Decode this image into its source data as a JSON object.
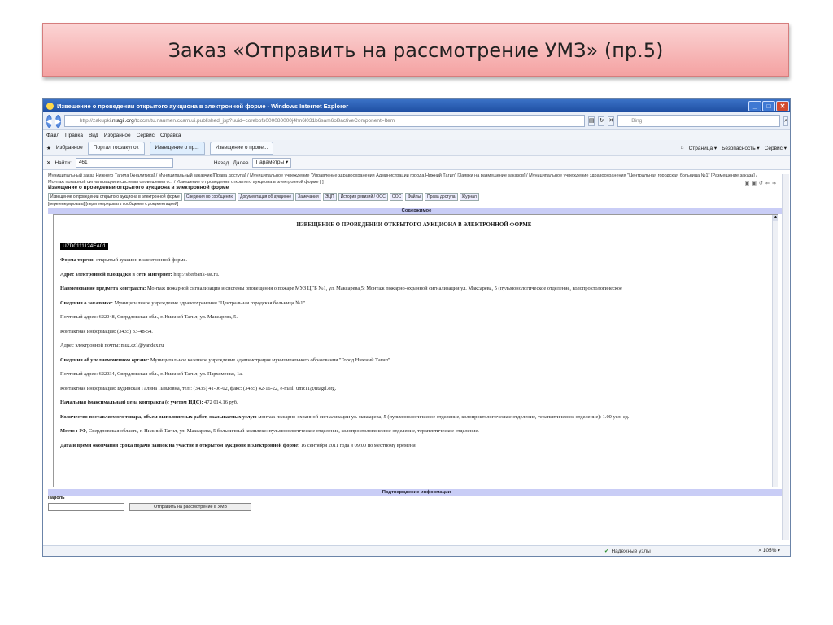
{
  "slide": {
    "title": "Заказ «Отправить на рассмотрение УМЗ» (пр.5)"
  },
  "window": {
    "title": "Извещение о проведении открытого аукциона в электронной форме - Windows Internet Explorer"
  },
  "address": {
    "url_prefix": "http://zakupki.",
    "url_domain": "ntagil.org",
    "url_rest": "/tcccm/tu.naumen.ccam.ui.published_jsp?uuid=corebofs000080000j4hn6l031b6sam6oBactiveComponent=Item",
    "search_placeholder": "Bing"
  },
  "menu": [
    "Файл",
    "Правка",
    "Вид",
    "Избранное",
    "Сервис",
    "Справка"
  ],
  "favorites": {
    "label": "Избранное",
    "tabs": [
      "Портал госзакупок",
      "Извещение о пр...",
      "Извещение о прове..."
    ],
    "tools": [
      "Страница ▾",
      "Безопасность ▾",
      "Сервис ▾"
    ]
  },
  "find": {
    "label": "Найти:",
    "value": "461",
    "prev": "Назад",
    "next": "Далее",
    "params": "Параметры ▾"
  },
  "breadcrumb": "Муниципальный заказ Нижнего Тагила [Аналитика] / Муниципальный заказчик [Права доступа] / Муниципальное учреждение \"Управление здравоохранения Администрации города Нижний Тагил\" [Заявки на размещение заказов] / Муниципальное учреждение здравоохранения \"Центральная городская больница №1\" [Размещение заказа] / Монтаж пожарной сигнализации и системы оповещения о... / Извещение о проведении открытого аукциона в электронной форме [ ]",
  "page_title": "Извещение о проведении открытого аукциона в электронной форме",
  "tabs": [
    "Извещение о проведении открытого аукциона в электронной форме",
    "Сведения по сообщению",
    "Документация об аукционе",
    "Замечания",
    "ЭЦП",
    "История ревизий / ООС",
    "ООС",
    "Файлы",
    "Права доступа",
    "Журнал"
  ],
  "regen": "[перегенерировать] [перегенерировать сообщение с документацией]",
  "section_title": "Содержимое",
  "document": {
    "title": "ИЗВЕЩЕНИЕ О ПРОВЕДЕНИИ ОТКРЫТОГО АУКЦИОНА В ЭЛЕКТРОННОЙ ФОРМЕ",
    "code": "UZD0111124EA01",
    "lines": [
      {
        "b": "Форма торгов:",
        "t": " открытый аукцион в электронной форме."
      },
      {
        "b": "Адрес электронной площадки в сети Интернет:",
        "t": " http://sberbank-ast.ru."
      },
      {
        "b": "Наименование предмета контракта:",
        "t": " Монтаж пожарной сигнализации и системы оповещения о пожаре МУЗ ЦГБ №1, ул. Максарева,5: Монтаж пожарно-охранной сигнализации ул. Максарева, 5 (пульмонологическое отделение, колопроктологическое"
      },
      {
        "b": "Сведения о заказчике:",
        "t": " Муниципальное учреждение здравоохранения \"Центральная городская больница №1\"."
      },
      {
        "b": "",
        "t": "Почтовый адрес: 622048, Свердловская обл., г. Нижний Тагил, ул. Максарева, 5."
      },
      {
        "b": "",
        "t": "Контактная информация: (3435) 33-48-54."
      },
      {
        "b": "",
        "t": "Адрес электронной почты: muz.cz1@yandex.ru"
      },
      {
        "b": "Сведения об уполномоченном органе:",
        "t": " Муниципальное казенное учреждение администрация муниципального образования \"Город Нижний Тагил\"."
      },
      {
        "b": "",
        "t": "Почтовый адрес: 622034, Свердловская обл., г. Нижний Тагил, ул. Пархоменко, 1а."
      },
      {
        "b": "",
        "t": "Контактная информация: Будинская Галина Павловна, тел.: (3435) 41-06-02, факс: (3435) 42-16-22, e-mail: umz11@ntagil.org."
      },
      {
        "b": "Начальная (максимальная) цена контракта (с учетом НДС):",
        "t": " 472 014.16 руб."
      },
      {
        "b": "Количество поставляемого товара, объем выполняемых работ, оказываемых услуг:",
        "t": " монтаж пожарно-охранной сигнализации ул. максарева, 5 (пульмонологическое отделение, колопроктологическое отделение, терапевтическое отделение): 1.00 усл. ед."
      },
      {
        "b": "Место :",
        "t": " РФ, Свердловская область, г. Нижний Тагил, ул. Максарева, 5 больничный комплекс: пульмонологическое отделение, колопроктологическое отделение, терапевтическое отделение."
      },
      {
        "b": "Дата и время окончания срока подачи заявок на участие в открытом аукционе в электронной форме:",
        "t": " 16 сентября 2011 года в 09:00 по местному времени."
      }
    ]
  },
  "confirm": {
    "title": "Подтверждение информации",
    "password_label": "Пароль",
    "send_button": "Отправить на рассмотрение в УМЗ"
  },
  "status": {
    "safe": "Надежные узлы",
    "zoom": "105%"
  }
}
